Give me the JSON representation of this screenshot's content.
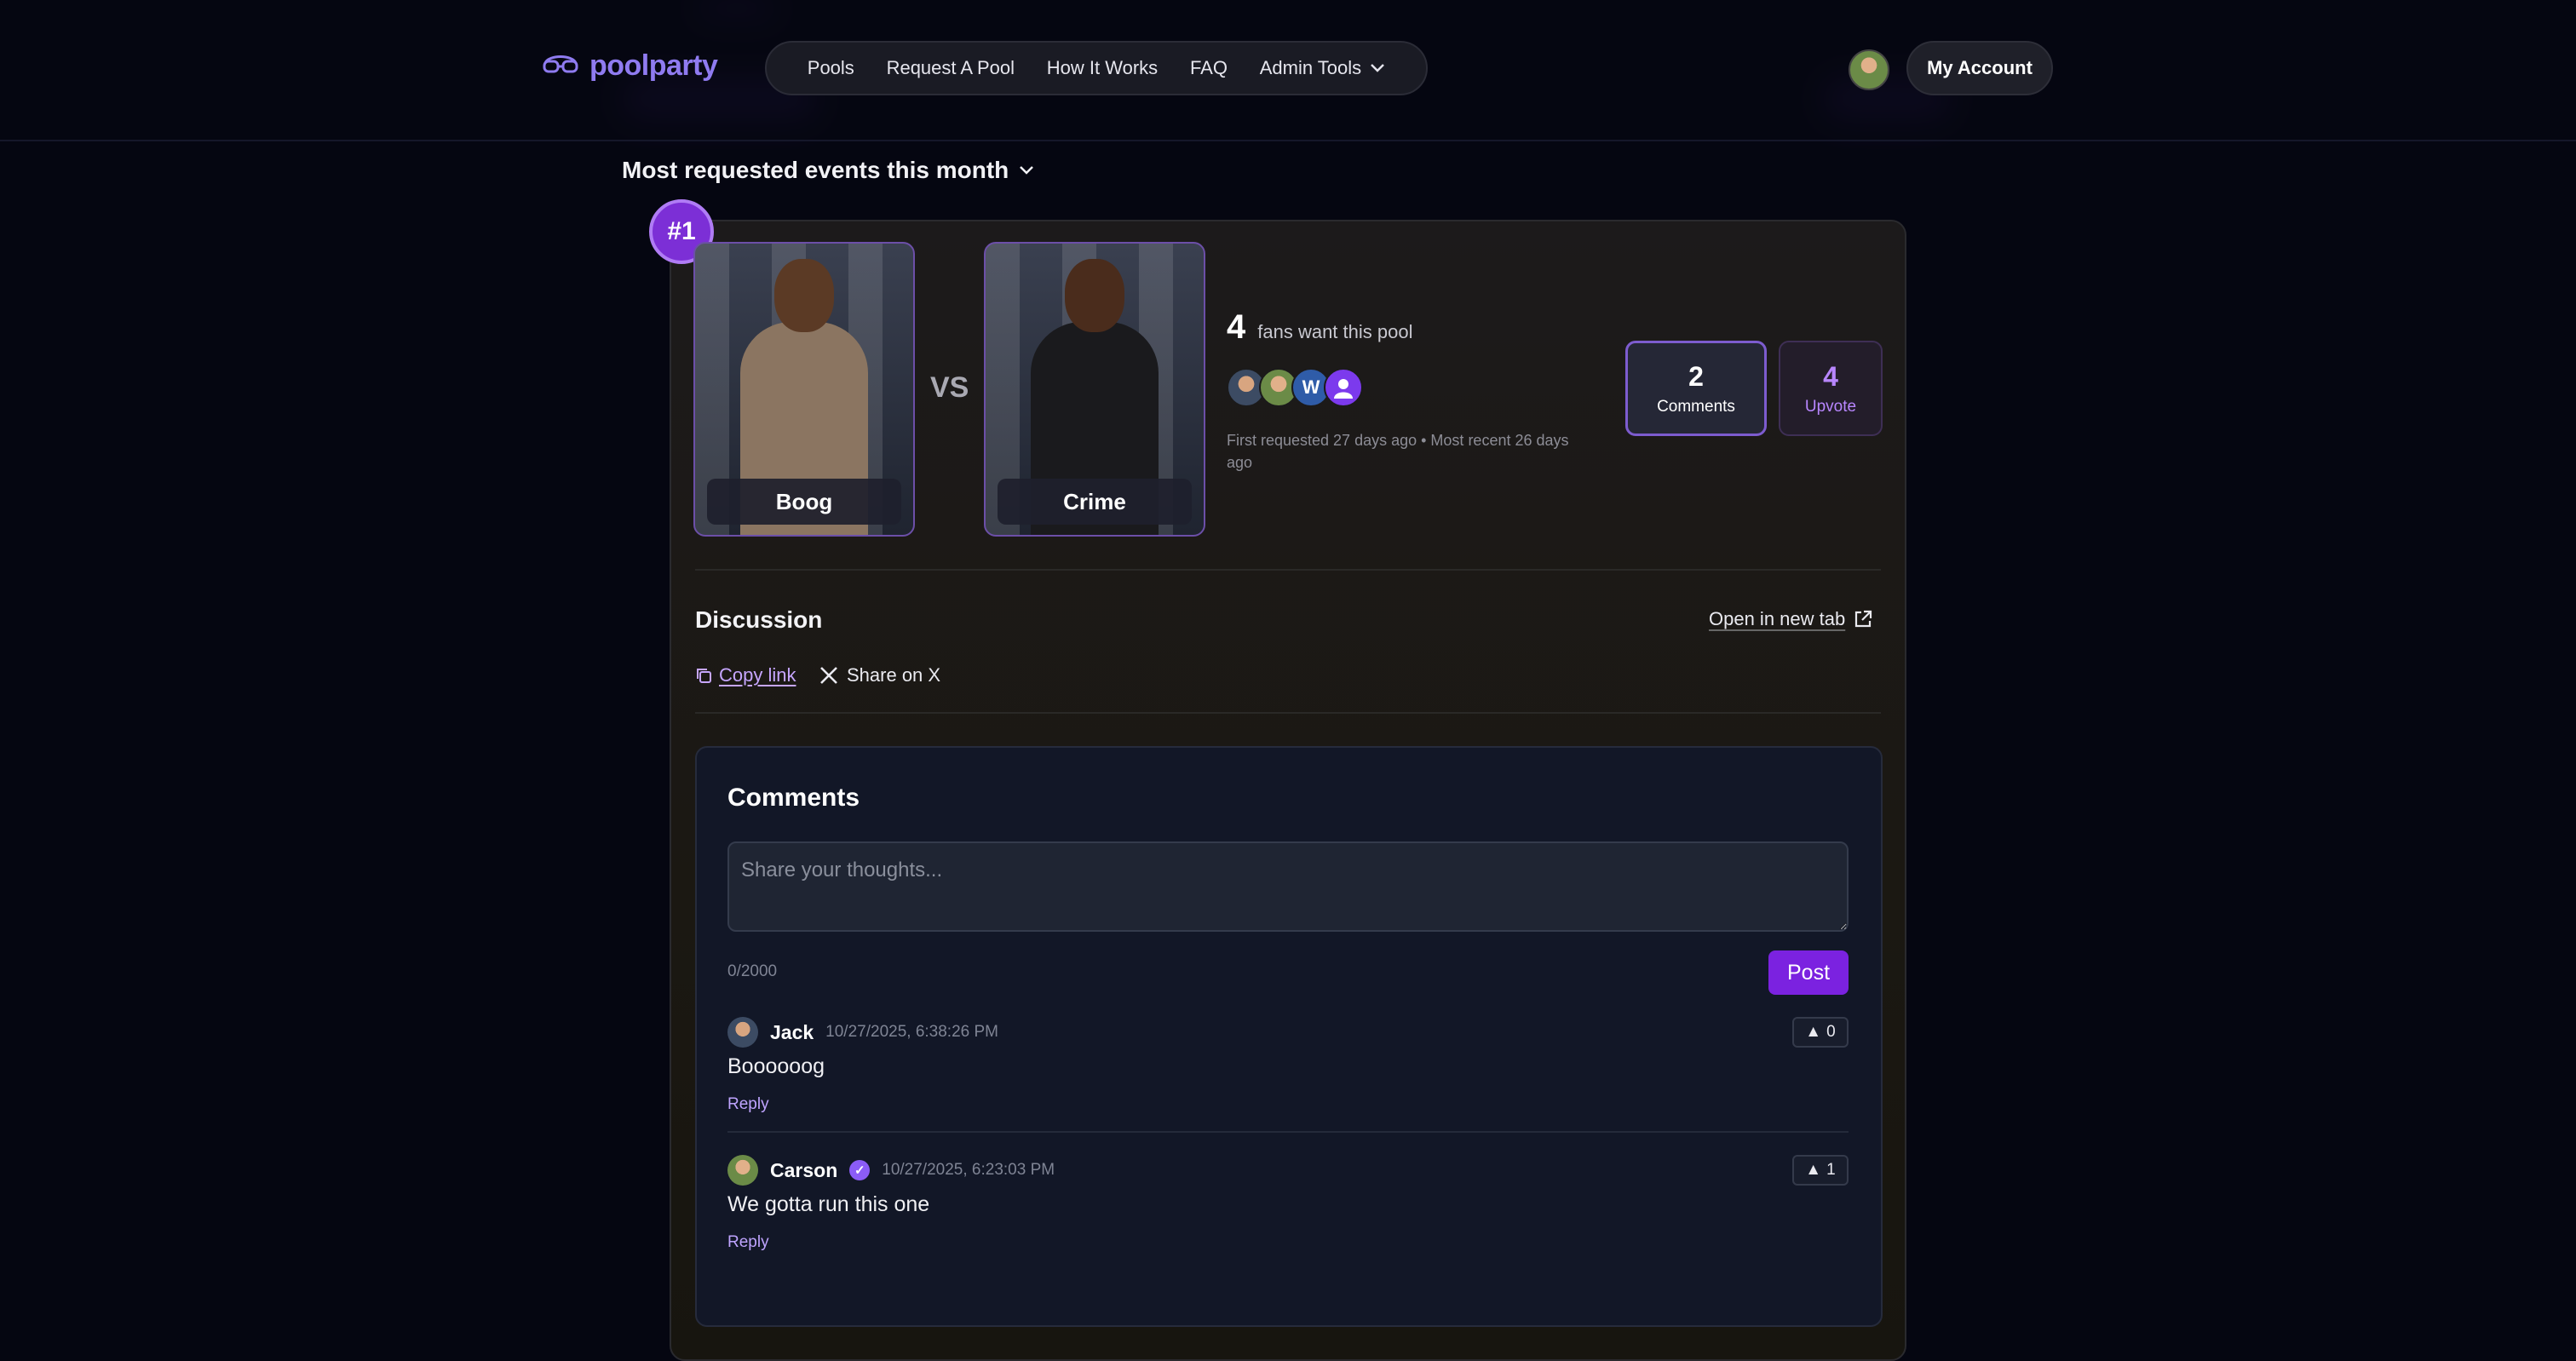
{
  "header": {
    "brand": "poolparty",
    "nav": [
      {
        "label": "Pools"
      },
      {
        "label": "Request A Pool"
      },
      {
        "label": "How It Works"
      },
      {
        "label": "FAQ"
      },
      {
        "label": "Admin Tools"
      }
    ],
    "account_label": "My Account"
  },
  "section": {
    "title": "Most requested events this month"
  },
  "event": {
    "rank": "#1",
    "fighter_a": "Boog",
    "fighter_b": "Crime",
    "vs": "VS",
    "fans_count": "4",
    "fans_label": "fans want this pool",
    "fan_initial": "W",
    "requested_text": "First requested 27 days ago • Most recent 26 days ago",
    "comments_count": "2",
    "comments_label": "Comments",
    "upvote_count": "4",
    "upvote_label": "Upvote"
  },
  "discussion": {
    "title": "Discussion",
    "open_new_tab": "Open in new tab",
    "copy_link": "Copy link",
    "share_x": "Share on X"
  },
  "comments": {
    "title": "Comments",
    "placeholder": "Share your thoughts...",
    "counter": "0/2000",
    "post_label": "Post",
    "items": [
      {
        "author": "Jack",
        "time": "10/27/2025, 6:38:26 PM",
        "text": "Boooooog",
        "reply": "Reply",
        "votes": "0",
        "verified": false
      },
      {
        "author": "Carson",
        "time": "10/27/2025, 6:23:03 PM",
        "text": "We gotta run this one",
        "reply": "Reply",
        "votes": "1",
        "verified": true
      }
    ]
  },
  "colors": {
    "accent": "#7b22e0",
    "accent_light": "#b18cff",
    "background": "#050611",
    "card": "#1b1812"
  },
  "icons": [
    "pool-goggles-icon",
    "chevron-down-icon",
    "external-link-icon",
    "copy-icon",
    "x-logo-icon",
    "verified-icon",
    "upvote-arrow-icon"
  ]
}
